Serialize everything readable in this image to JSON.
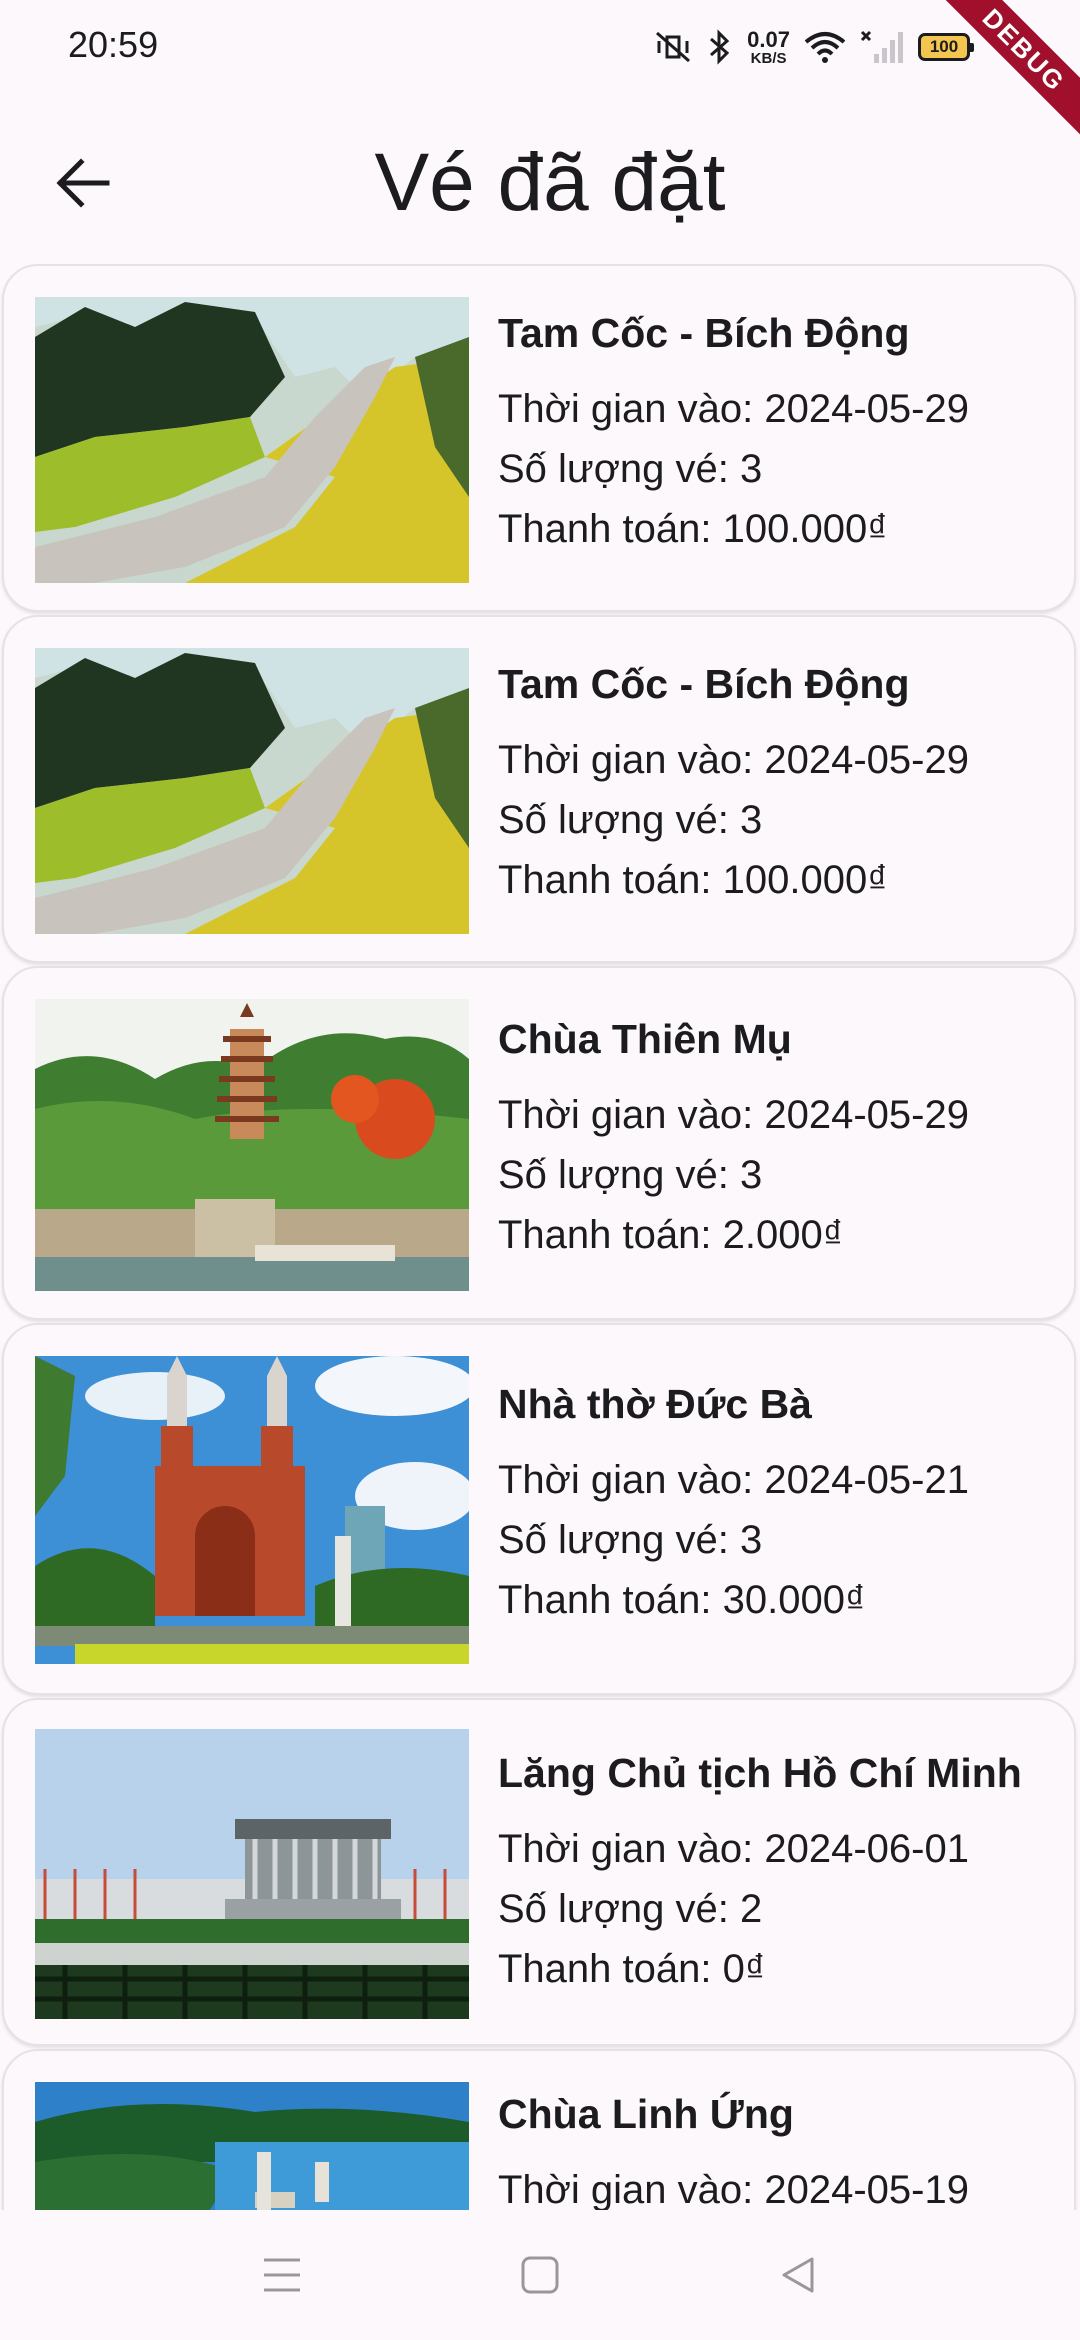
{
  "status_bar": {
    "time": "20:59",
    "net_speed_value": "0.07",
    "net_speed_unit": "KB/S",
    "battery": "100",
    "debug_label": "DEBUG"
  },
  "app_bar": {
    "title": "Vé đã đặt",
    "back_icon": "arrow-left-icon"
  },
  "tickets": [
    {
      "name": "Tam Cốc - Bích Động",
      "time_line": "Thời gian vào: 2024-05-29",
      "qty_line": "Số lượng vé: 3",
      "pay_line": "Thanh toán: 100.000₫",
      "image": "tam-coc-photo"
    },
    {
      "name": "Tam Cốc - Bích Động",
      "time_line": "Thời gian vào: 2024-05-29",
      "qty_line": "Số lượng vé: 3",
      "pay_line": "Thanh toán: 100.000₫",
      "image": "tam-coc-photo"
    },
    {
      "name": "Chùa Thiên Mụ",
      "time_line": "Thời gian vào: 2024-05-29",
      "qty_line": "Số lượng vé: 3",
      "pay_line": "Thanh toán: 2.000₫",
      "image": "thien-mu-pagoda-photo"
    },
    {
      "name": "Nhà thờ Đức Bà",
      "time_line": "Thời gian vào: 2024-05-21",
      "qty_line": "Số lượng vé: 3",
      "pay_line": "Thanh toán: 30.000₫",
      "image": "notre-dame-cathedral-photo"
    },
    {
      "name": "Lăng Chủ tịch Hồ Chí Minh",
      "time_line": "Thời gian vào: 2024-06-01",
      "qty_line": "Số lượng vé: 2",
      "pay_line": "Thanh toán: 0₫",
      "image": "ho-chi-minh-mausoleum-photo"
    },
    {
      "name": "Chùa Linh Ứng",
      "time_line": "Thời gian vào: 2024-05-19",
      "qty_line": "",
      "pay_line": "",
      "image": "linh-ung-pagoda-photo"
    }
  ],
  "nav_bar": {
    "menu_icon": "menu-icon",
    "home_icon": "home-square-icon",
    "back_icon": "back-triangle-icon"
  }
}
